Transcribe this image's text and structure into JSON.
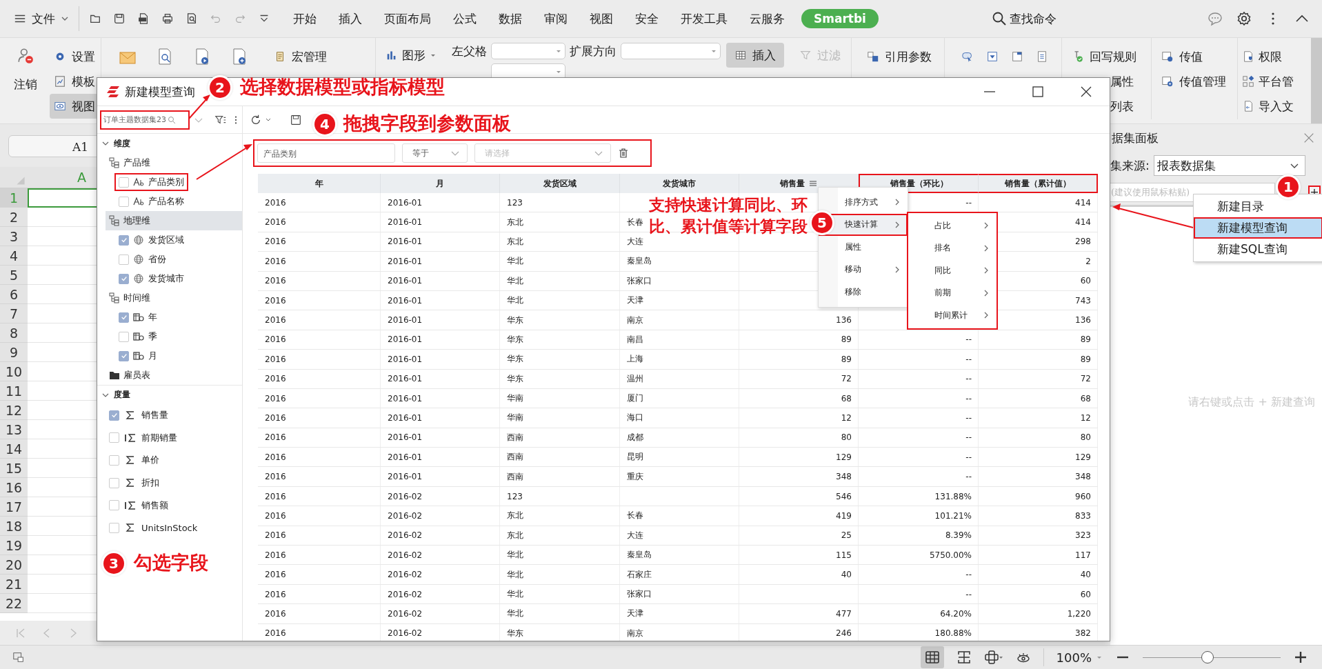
{
  "menubar": {
    "file": "文件",
    "tabs": [
      "开始",
      "插入",
      "页面布局",
      "公式",
      "数据",
      "审阅",
      "视图",
      "安全",
      "开发工具",
      "云服务"
    ],
    "brand": "Smartbi",
    "search": "查找命令"
  },
  "ribbon": {
    "logout": "注销",
    "settings": "设置",
    "template": "模板",
    "view": {
      "label": "视图",
      "selected": true
    },
    "macro": "宏管理",
    "chart": "图形",
    "left_parent": "左父格",
    "expand_dir": "扩展方向",
    "insert": {
      "label": "插入",
      "selected": true
    },
    "filter": {
      "label": "过滤",
      "disabled": true
    },
    "ref_params": "引用参数",
    "writeback": "回写规则",
    "attr": "属性",
    "list": "列表",
    "pass_value": "传值",
    "pass_manage": "传值管理",
    "permission": "权限",
    "platform": "平台管",
    "import": "导入文"
  },
  "sheet": {
    "name_box": "A1",
    "column": "A",
    "rows": [
      {
        "label": "1",
        "selected": true
      },
      {
        "label": "2",
        "selected": false
      },
      {
        "label": "3",
        "selected": false
      },
      {
        "label": "4",
        "selected": false
      },
      {
        "label": "5",
        "selected": false
      },
      {
        "label": "6",
        "selected": false
      },
      {
        "label": "7",
        "selected": false
      },
      {
        "label": "8",
        "selected": false
      },
      {
        "label": "9",
        "selected": false
      },
      {
        "label": "10",
        "selected": false
      },
      {
        "label": "11",
        "selected": false
      },
      {
        "label": "12",
        "selected": false
      },
      {
        "label": "13",
        "selected": false
      },
      {
        "label": "14",
        "selected": false
      },
      {
        "label": "15",
        "selected": false
      },
      {
        "label": "16",
        "selected": false
      },
      {
        "label": "17",
        "selected": false
      },
      {
        "label": "18",
        "selected": false
      },
      {
        "label": "19",
        "selected": false
      },
      {
        "label": "20",
        "selected": false
      },
      {
        "label": "21",
        "selected": false
      },
      {
        "label": "22",
        "selected": false
      }
    ]
  },
  "panel": {
    "title": "据集面板",
    "source_label": "集来源:",
    "source": "报表数据集",
    "paste_placeholder": "(建议使用鼠标粘贴)",
    "add": "+",
    "menu": [
      {
        "label": "新建目录",
        "selected": false
      },
      {
        "label": "新建模型查询",
        "selected": true
      },
      {
        "label": "新建SQL查询",
        "selected": false
      }
    ],
    "empty_hint": "请右键或点击 + 新建查询"
  },
  "status": {
    "zoom": "100%",
    "level": 0.47
  },
  "dialog": {
    "title": "新建模型查询",
    "search": "订单主题数据集23",
    "tree": [
      {
        "label": "维度",
        "kind": "section",
        "expanded": true,
        "children": [
          {
            "label": "产品维",
            "kind": "group",
            "selected": false,
            "children": [
              {
                "label": "产品类别",
                "kind": "text",
                "checked": false,
                "highlighted": true
              },
              {
                "label": "产品名称",
                "kind": "text",
                "checked": false,
                "highlighted": false
              }
            ]
          },
          {
            "label": "地理维",
            "kind": "group",
            "selected": true,
            "children": [
              {
                "label": "发货区域",
                "kind": "geo",
                "checked": true,
                "highlighted": false
              },
              {
                "label": "省份",
                "kind": "geo",
                "checked": false,
                "highlighted": false
              },
              {
                "label": "发货城市",
                "kind": "geo",
                "checked": true,
                "highlighted": false
              }
            ]
          },
          {
            "label": "时间维",
            "kind": "group",
            "selected": false,
            "children": [
              {
                "label": "年",
                "kind": "time",
                "checked": true,
                "highlighted": false
              },
              {
                "label": "季",
                "kind": "time",
                "checked": false,
                "highlighted": false
              },
              {
                "label": "月",
                "kind": "time",
                "checked": true,
                "highlighted": false
              }
            ]
          },
          {
            "label": "雇员表",
            "kind": "folder",
            "selected": false
          }
        ]
      },
      {
        "label": "度量",
        "kind": "section",
        "expanded": true,
        "children": [
          {
            "label": "销售量",
            "kind": "measure",
            "checked": true,
            "highlighted": false
          },
          {
            "label": "前期销量",
            "kind": "calc",
            "checked": false,
            "highlighted": false
          },
          {
            "label": "单价",
            "kind": "measure",
            "checked": false,
            "highlighted": false
          },
          {
            "label": "折扣",
            "kind": "measure",
            "checked": false,
            "highlighted": false
          },
          {
            "label": "销售额",
            "kind": "calc",
            "checked": false,
            "highlighted": false
          },
          {
            "label": "UnitsInStock",
            "kind": "measure",
            "checked": false,
            "highlighted": false
          }
        ]
      }
    ],
    "filter": {
      "field": "产品类别",
      "operator": "等于",
      "value_placeholder": "请选择"
    },
    "columns": [
      {
        "label": "年",
        "kind": "text",
        "menu": false,
        "highlighted": false
      },
      {
        "label": "月",
        "kind": "text",
        "menu": false,
        "highlighted": false
      },
      {
        "label": "发货区域",
        "kind": "text",
        "menu": false,
        "highlighted": false
      },
      {
        "label": "发货城市",
        "kind": "text",
        "menu": false,
        "highlighted": false
      },
      {
        "label": "销售量",
        "kind": "number",
        "menu": true,
        "highlighted": false
      },
      {
        "label": "销售量（环比）",
        "kind": "number",
        "menu": false,
        "highlighted": true
      },
      {
        "label": "销售量（累计值）",
        "kind": "number",
        "menu": false,
        "highlighted": true
      }
    ],
    "rows": [
      [
        "2016",
        "2016-01",
        "123",
        null,
        null,
        "--",
        "414"
      ],
      [
        "2016",
        "2016-01",
        "东北",
        "长春",
        null,
        null,
        "414"
      ],
      [
        "2016",
        "2016-01",
        "东北",
        "大连",
        null,
        null,
        "298"
      ],
      [
        "2016",
        "2016-01",
        "华北",
        "秦皇岛",
        null,
        null,
        "2"
      ],
      [
        "2016",
        "2016-01",
        "华北",
        "张家口",
        null,
        null,
        "60"
      ],
      [
        "2016",
        "2016-01",
        "华北",
        "天津",
        null,
        null,
        "743"
      ],
      [
        "2016",
        "2016-01",
        "华东",
        "南京",
        "136",
        null,
        "136"
      ],
      [
        "2016",
        "2016-01",
        "华东",
        "南昌",
        "89",
        "--",
        "89"
      ],
      [
        "2016",
        "2016-01",
        "华东",
        "上海",
        "89",
        "--",
        "89"
      ],
      [
        "2016",
        "2016-01",
        "华东",
        "温州",
        "72",
        "--",
        "72"
      ],
      [
        "2016",
        "2016-01",
        "华南",
        "厦门",
        "68",
        "--",
        "68"
      ],
      [
        "2016",
        "2016-01",
        "华南",
        "海口",
        "12",
        "--",
        "12"
      ],
      [
        "2016",
        "2016-01",
        "西南",
        "成都",
        "80",
        "--",
        "80"
      ],
      [
        "2016",
        "2016-01",
        "西南",
        "昆明",
        "129",
        "--",
        "129"
      ],
      [
        "2016",
        "2016-01",
        "西南",
        "重庆",
        "348",
        "--",
        "348"
      ],
      [
        "2016",
        "2016-02",
        "123",
        null,
        "546",
        "131.88%",
        "960"
      ],
      [
        "2016",
        "2016-02",
        "东北",
        "长春",
        "419",
        "101.21%",
        "833"
      ],
      [
        "2016",
        "2016-02",
        "东北",
        "大连",
        "25",
        "8.39%",
        "323"
      ],
      [
        "2016",
        "2016-02",
        "华北",
        "秦皇岛",
        "115",
        "5750.00%",
        "117"
      ],
      [
        "2016",
        "2016-02",
        "华北",
        "石家庄",
        "40",
        "--",
        "40"
      ],
      [
        "2016",
        "2016-02",
        "华北",
        "张家口",
        null,
        "--",
        "60"
      ],
      [
        "2016",
        "2016-02",
        "华北",
        "天津",
        "477",
        "64.20%",
        "1,220"
      ],
      [
        "2016",
        "2016-02",
        "华东",
        "南京",
        "246",
        "180.88%",
        "382"
      ]
    ],
    "context_menu": [
      {
        "label": "排序方式",
        "submenu": true,
        "selected": false
      },
      {
        "label": "快速计算",
        "submenu": true,
        "selected": true
      },
      {
        "label": "属性",
        "submenu": false,
        "selected": false
      },
      {
        "label": "移动",
        "submenu": true,
        "selected": false
      },
      {
        "label": "移除",
        "submenu": false,
        "selected": false
      }
    ],
    "submenu": [
      "占比",
      "排名",
      "同比",
      "前期",
      "时间累计"
    ]
  },
  "callouts": [
    {
      "number": "1"
    },
    {
      "number": "2",
      "text": "选择数据模型或指标模型"
    },
    {
      "number": "3",
      "text": "勾选字段"
    },
    {
      "number": "4",
      "text": "拖拽字段到参数面板"
    },
    {
      "number": "5",
      "lines": [
        "支持快速计算同比、环",
        "比、累计值等计算字段"
      ]
    }
  ]
}
